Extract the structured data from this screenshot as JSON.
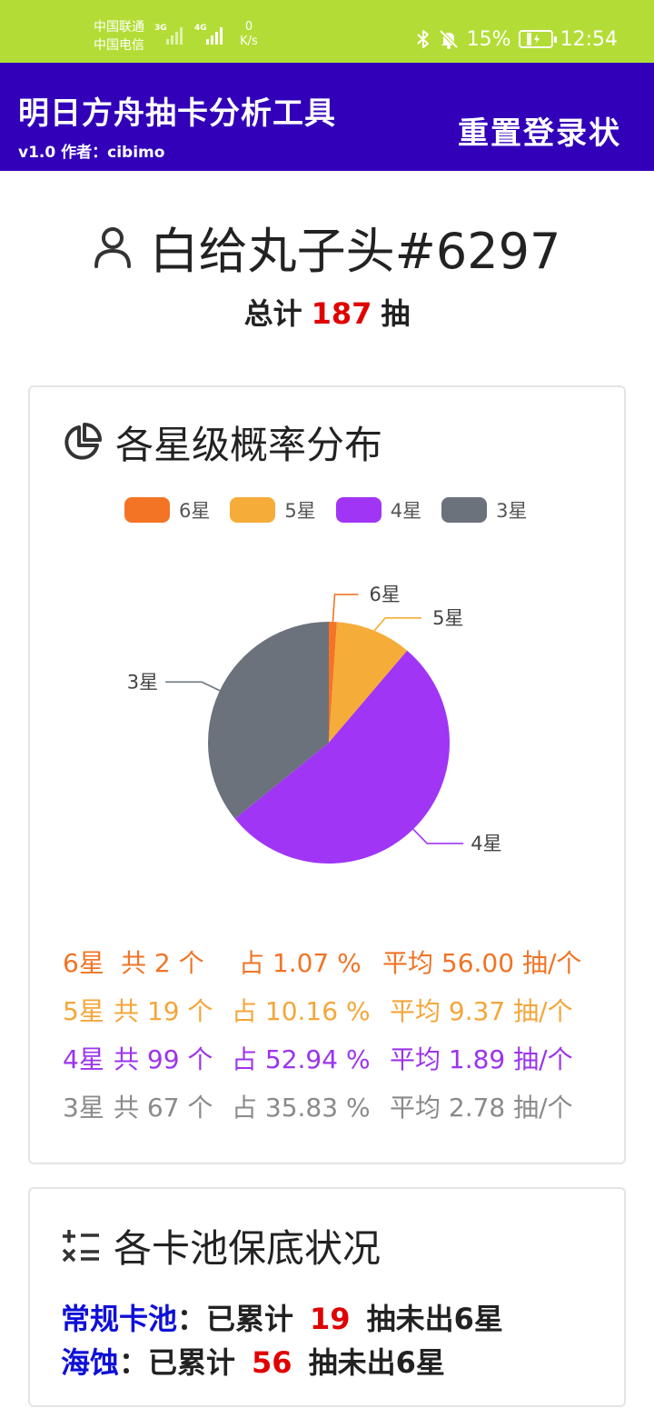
{
  "status_bar": {
    "carrier_1": "中国联通",
    "carrier_2": "中国电信",
    "net_1": "3G",
    "net_2": "4G",
    "speed_value": "0",
    "speed_unit": "K/s",
    "battery": "15%",
    "time": "12:54"
  },
  "header": {
    "title": "明日方舟抽卡分析工具",
    "subtitle": "v1.0  作者：cibimo",
    "reset_label": "重置登录状"
  },
  "user": {
    "name": "白给丸子头#6297",
    "total_prefix": "总计",
    "total_count": "187",
    "total_suffix": "抽"
  },
  "distribution": {
    "title": "各星级概率分布",
    "legend": [
      "6星",
      "5星",
      "4星",
      "3星"
    ],
    "stats": [
      {
        "star": "6星",
        "count": "共 2 个",
        "pct": "占 1.07 %",
        "avg": "平均 56.00 抽/个"
      },
      {
        "star": "5星",
        "count": "共 19 个",
        "pct": "占 10.16 %",
        "avg": "平均 9.37 抽/个"
      },
      {
        "star": "4星",
        "count": "共 99 个",
        "pct": "占 52.94 %",
        "avg": "平均 1.89 抽/个"
      },
      {
        "star": "3星",
        "count": "共 67 个",
        "pct": "占 35.83 %",
        "avg": "平均 2.78 抽/个"
      }
    ]
  },
  "chart_data": {
    "type": "pie",
    "categories": [
      "6星",
      "5星",
      "4星",
      "3星"
    ],
    "values": [
      2,
      19,
      99,
      67
    ],
    "colors": [
      "#f47425",
      "#f6ac38",
      "#a035f5",
      "#6b727c"
    ],
    "legend_position": "top"
  },
  "pools": {
    "title": "各卡池保底状况",
    "rows": [
      {
        "name": "常规卡池",
        "sep": "：已累计",
        "count": "19",
        "suffix": "抽未出6星"
      },
      {
        "name": "海蚀",
        "sep": "：已累计",
        "count": "56",
        "suffix": "抽未出6星"
      }
    ]
  }
}
